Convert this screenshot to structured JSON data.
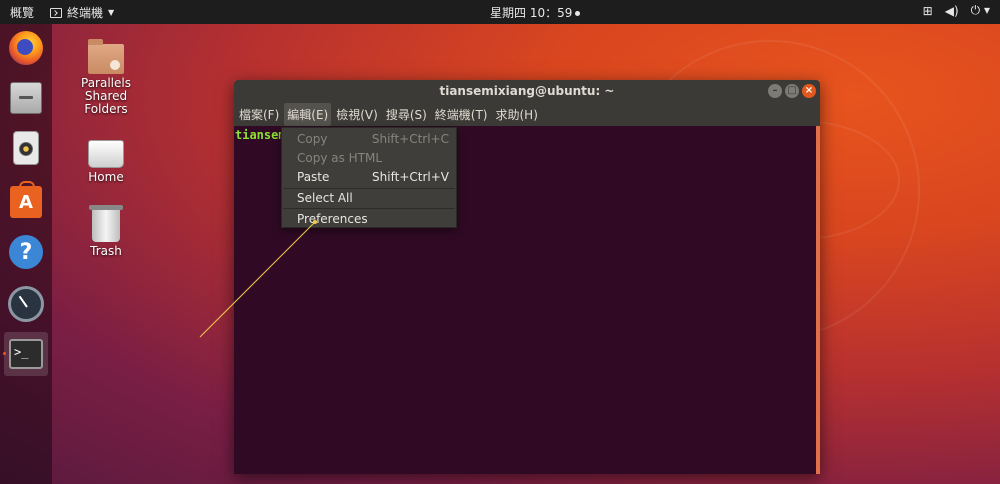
{
  "topbar": {
    "activities": "概覽",
    "app_menu": "終端機",
    "clock": "星期四 10：59",
    "tray_icons": [
      "network-icon",
      "volume-icon",
      "power-icon"
    ]
  },
  "dock": {
    "items": [
      {
        "name": "firefox",
        "icon": "firefox-icon"
      },
      {
        "name": "files",
        "icon": "files-icon"
      },
      {
        "name": "rhythmbox",
        "icon": "speaker-icon"
      },
      {
        "name": "software",
        "icon": "store-icon",
        "glyph": "A"
      },
      {
        "name": "help",
        "icon": "help-icon",
        "glyph": "?"
      },
      {
        "name": "dial",
        "icon": "dial-icon"
      },
      {
        "name": "terminal",
        "icon": "terminal-icon",
        "glyph": ">_",
        "active": true
      }
    ]
  },
  "desktop": {
    "icons": [
      {
        "label": "Parallels Shared Folders"
      },
      {
        "label": "Home"
      },
      {
        "label": "Trash"
      }
    ]
  },
  "terminal": {
    "title": "tiansemixiang@ubuntu: ~",
    "menus": [
      "檔案(F)",
      "編輯(E)",
      "檢視(V)",
      "搜尋(S)",
      "終端機(T)",
      "求助(H)"
    ],
    "open_menu": "編輯(E)",
    "prompt": "tiansem"
  },
  "edit_menu": {
    "items": [
      {
        "label": "Copy",
        "shortcut": "Shift+Ctrl+C",
        "enabled": false
      },
      {
        "label": "Copy as HTML",
        "shortcut": "",
        "enabled": false
      },
      {
        "label": "Paste",
        "shortcut": "Shift+Ctrl+V",
        "enabled": true
      },
      {
        "label": "Select All",
        "shortcut": "",
        "enabled": true
      },
      {
        "label": "Preferences",
        "shortcut": "",
        "enabled": true
      }
    ]
  },
  "colors": {
    "terminal_bg": "#300a24",
    "prompt": "#8ae234",
    "accent": "#e9541f",
    "annotation_line": "#f2c94c"
  }
}
